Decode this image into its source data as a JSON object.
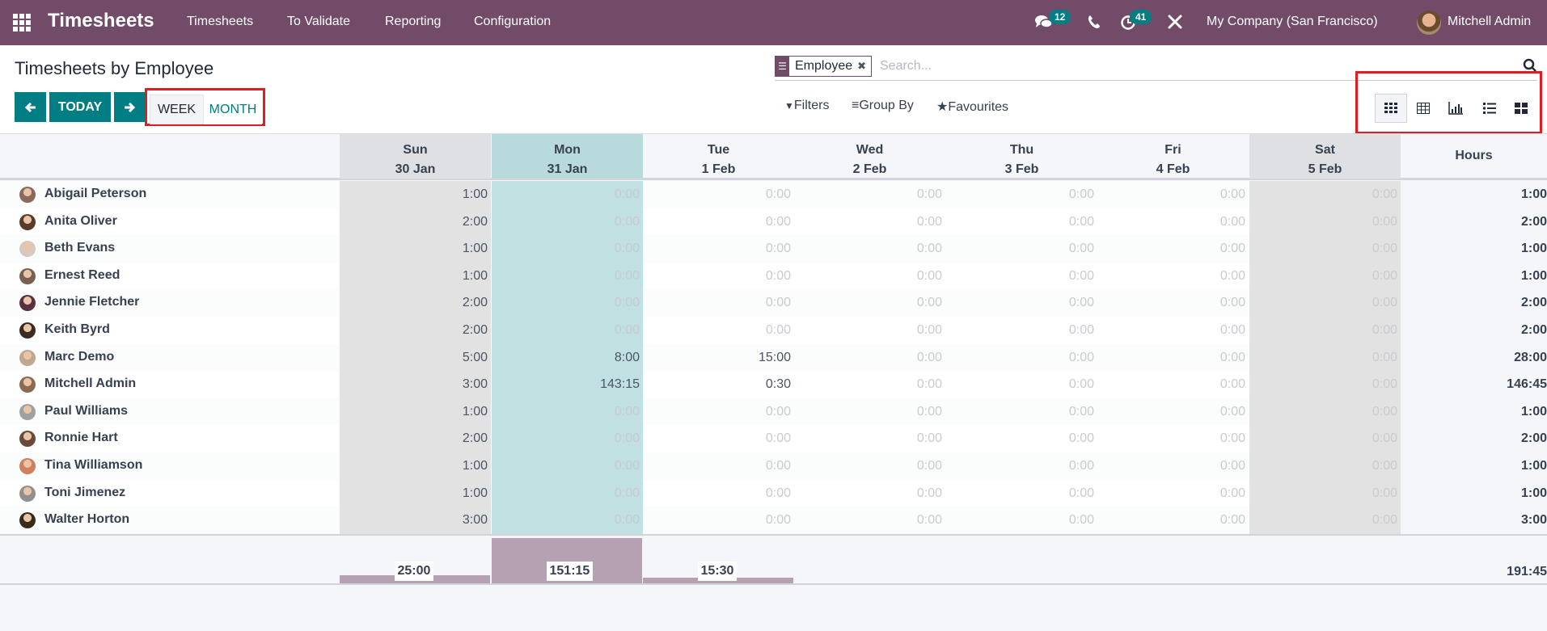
{
  "navbar": {
    "app_name": "Timesheets",
    "menu": [
      "Timesheets",
      "To Validate",
      "Reporting",
      "Configuration"
    ],
    "messages_badge": "12",
    "activities_badge": "41",
    "company": "My Company (San Francisco)",
    "user": "Mitchell Admin",
    "icons": [
      "apps-grid-icon",
      "chat-icon",
      "phone-icon",
      "clock-icon",
      "tools-icon"
    ]
  },
  "control": {
    "title": "Timesheets by Employee",
    "today_label": "TODAY",
    "week_label": "WEEK",
    "month_label": "MONTH",
    "search": {
      "facet_label": "Employee",
      "placeholder": "Search..."
    },
    "filters_label": "Filters",
    "groupby_label": "Group By",
    "favourites_label": "Favourites",
    "views": [
      "grid",
      "pivot",
      "graph",
      "list",
      "kanban"
    ],
    "active_view": "grid"
  },
  "grid": {
    "columns": [
      {
        "day": "Sun",
        "date": "30 Jan",
        "type": "weekend"
      },
      {
        "day": "Mon",
        "date": "31 Jan",
        "type": "today"
      },
      {
        "day": "Tue",
        "date": "1 Feb",
        "type": "normal"
      },
      {
        "day": "Wed",
        "date": "2 Feb",
        "type": "normal"
      },
      {
        "day": "Thu",
        "date": "3 Feb",
        "type": "normal"
      },
      {
        "day": "Fri",
        "date": "4 Feb",
        "type": "normal"
      },
      {
        "day": "Sat",
        "date": "5 Feb",
        "type": "weekend"
      }
    ],
    "total_header": "Hours",
    "rows": [
      {
        "name": "Abigail Peterson",
        "values": [
          "1:00",
          "0:00",
          "0:00",
          "0:00",
          "0:00",
          "0:00",
          "0:00"
        ],
        "total": "1:00"
      },
      {
        "name": "Anita Oliver",
        "values": [
          "2:00",
          "0:00",
          "0:00",
          "0:00",
          "0:00",
          "0:00",
          "0:00"
        ],
        "total": "2:00"
      },
      {
        "name": "Beth Evans",
        "values": [
          "1:00",
          "0:00",
          "0:00",
          "0:00",
          "0:00",
          "0:00",
          "0:00"
        ],
        "total": "1:00"
      },
      {
        "name": "Ernest Reed",
        "values": [
          "1:00",
          "0:00",
          "0:00",
          "0:00",
          "0:00",
          "0:00",
          "0:00"
        ],
        "total": "1:00"
      },
      {
        "name": "Jennie Fletcher",
        "values": [
          "2:00",
          "0:00",
          "0:00",
          "0:00",
          "0:00",
          "0:00",
          "0:00"
        ],
        "total": "2:00"
      },
      {
        "name": "Keith Byrd",
        "values": [
          "2:00",
          "0:00",
          "0:00",
          "0:00",
          "0:00",
          "0:00",
          "0:00"
        ],
        "total": "2:00"
      },
      {
        "name": "Marc Demo",
        "values": [
          "5:00",
          "8:00",
          "15:00",
          "0:00",
          "0:00",
          "0:00",
          "0:00"
        ],
        "total": "28:00"
      },
      {
        "name": "Mitchell Admin",
        "values": [
          "3:00",
          "143:15",
          "0:30",
          "0:00",
          "0:00",
          "0:00",
          "0:00"
        ],
        "total": "146:45"
      },
      {
        "name": "Paul Williams",
        "values": [
          "1:00",
          "0:00",
          "0:00",
          "0:00",
          "0:00",
          "0:00",
          "0:00"
        ],
        "total": "1:00"
      },
      {
        "name": "Ronnie Hart",
        "values": [
          "2:00",
          "0:00",
          "0:00",
          "0:00",
          "0:00",
          "0:00",
          "0:00"
        ],
        "total": "2:00"
      },
      {
        "name": "Tina Williamson",
        "values": [
          "1:00",
          "0:00",
          "0:00",
          "0:00",
          "0:00",
          "0:00",
          "0:00"
        ],
        "total": "1:00"
      },
      {
        "name": "Toni Jimenez",
        "values": [
          "1:00",
          "0:00",
          "0:00",
          "0:00",
          "0:00",
          "0:00",
          "0:00"
        ],
        "total": "1:00"
      },
      {
        "name": "Walter Horton",
        "values": [
          "3:00",
          "0:00",
          "0:00",
          "0:00",
          "0:00",
          "0:00",
          "0:00"
        ],
        "total": "3:00"
      }
    ],
    "column_totals": [
      {
        "label": "25:00",
        "hours": 25.0
      },
      {
        "label": "151:15",
        "hours": 151.25
      },
      {
        "label": "15:30",
        "hours": 15.5
      },
      {
        "label": "",
        "hours": 0
      },
      {
        "label": "",
        "hours": 0
      },
      {
        "label": "",
        "hours": 0
      },
      {
        "label": "",
        "hours": 0
      }
    ],
    "grand_total": "191:45"
  },
  "colors": {
    "brand": "#714b67",
    "accent": "#017e84",
    "highlight_box": "#e31b23",
    "bar": "#b5a1b2"
  }
}
